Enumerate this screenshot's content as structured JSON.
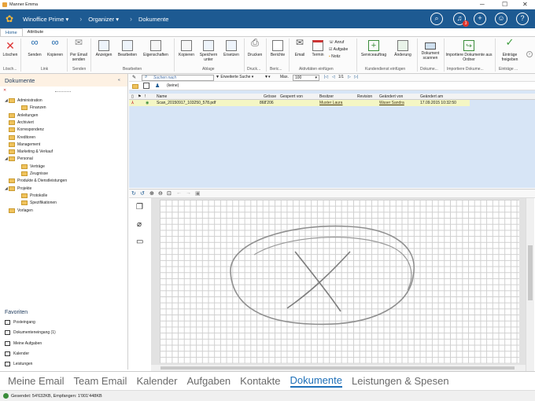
{
  "window": {
    "title": "Manner Emma"
  },
  "appbar": {
    "app": "Winoffice Prime",
    "section": "Organizer",
    "page": "Dokumente",
    "badge": "3"
  },
  "ribbon_tabs": [
    "Home",
    "Attribute"
  ],
  "ribbon": {
    "buttons": [
      {
        "label": "Löschen",
        "icon": "delete-icon"
      },
      {
        "label": "Senden",
        "icon": "link-icon"
      },
      {
        "label": "Kopieren",
        "icon": "link-copy-icon"
      },
      {
        "label": "Per Email senden",
        "icon": "email-send-icon"
      },
      {
        "label": "Anzeigen",
        "icon": "view-icon"
      },
      {
        "label": "Bearbeiten",
        "icon": "edit-icon"
      },
      {
        "label": "Eigenschaften",
        "icon": "properties-icon"
      },
      {
        "label": "Kopieren",
        "icon": "copy-icon"
      },
      {
        "label": "Speichern unter",
        "icon": "save-as-icon"
      },
      {
        "label": "Ersetzen",
        "icon": "replace-icon"
      },
      {
        "label": "Drucken",
        "icon": "print-icon"
      },
      {
        "label": "Berichte",
        "icon": "report-icon"
      },
      {
        "label": "Email",
        "icon": "email-icon"
      },
      {
        "label": "Termin",
        "icon": "calendar-icon"
      },
      {
        "label": "Anruf",
        "icon": "phone-icon"
      },
      {
        "label": "Aufgabe",
        "icon": "task-icon"
      },
      {
        "label": "Notiz",
        "icon": "note-icon"
      },
      {
        "label": "Serviceauftrag",
        "icon": "service-icon"
      },
      {
        "label": "Änderung",
        "icon": "change-icon"
      },
      {
        "label": "Dokument scannen",
        "icon": "scanner-icon"
      },
      {
        "label": "Importiere Dokumente aus Ordner",
        "icon": "import-icon"
      },
      {
        "label": "Einträge freigeben",
        "icon": "check-icon"
      }
    ],
    "groups": [
      "Lösch...",
      "Link",
      "Senden",
      "Bearbeiten",
      "Ablage",
      "Druck...",
      "Beric...",
      "Aktivitäten einfügen",
      "Kundendienst einfügen",
      "Dokume...",
      "Importiere Dokume...",
      "Einträge ..."
    ]
  },
  "left": {
    "title": "Dokumente",
    "tree": [
      {
        "label": "Administration",
        "level": 0,
        "tw": "◢"
      },
      {
        "label": "Finanzen",
        "level": 1,
        "tw": ""
      },
      {
        "label": "Anleitungen",
        "level": 0,
        "tw": ""
      },
      {
        "label": "Archiviert",
        "level": 0,
        "tw": ""
      },
      {
        "label": "Korrespondenz",
        "level": 0,
        "tw": ""
      },
      {
        "label": "Kreditoren",
        "level": 0,
        "tw": ""
      },
      {
        "label": "Management",
        "level": 0,
        "tw": ""
      },
      {
        "label": "Marketing & Verkauf",
        "level": 0,
        "tw": ""
      },
      {
        "label": "Personal",
        "level": 0,
        "tw": "◢"
      },
      {
        "label": "Verträge",
        "level": 1,
        "tw": ""
      },
      {
        "label": "Zeugnisse",
        "level": 1,
        "tw": ""
      },
      {
        "label": "Produkte & Dienstleistungen",
        "level": 0,
        "tw": ""
      },
      {
        "label": "Projekte",
        "level": 0,
        "tw": "◢"
      },
      {
        "label": "Protokolle",
        "level": 1,
        "tw": ""
      },
      {
        "label": "Spezifikationen",
        "level": 1,
        "tw": ""
      },
      {
        "label": "Vorlagen",
        "level": 0,
        "tw": ""
      }
    ],
    "fav_title": "Favoriten",
    "favorites": [
      "Posteingang",
      "Dokumenteneingang (1)",
      "Meine Aufgaben",
      "Kalender",
      "Leistungen"
    ]
  },
  "search": {
    "placeholder": "Suchen nach",
    "adv": "Erweiterte Suche",
    "max_label": "Max.",
    "max_value": "100",
    "page": "1/1",
    "filter": "(keine)"
  },
  "grid": {
    "headers": [
      "Name",
      "Grösse",
      "Gesperrt von",
      "Besitzer",
      "Revision",
      "Geändert von",
      "Geändert am"
    ],
    "row": {
      "name": "Scan_20150917_103250_578.pdf",
      "size": "868'206",
      "locked": "",
      "owner": "Muster Laura",
      "revision": "",
      "changed_by": "Waser Sandra",
      "changed_at": "17.09.2015 10:32:50"
    }
  },
  "nav": [
    "Meine Email",
    "Team Email",
    "Kalender",
    "Aufgaben",
    "Kontakte",
    "Dokumente",
    "Leistungen & Spesen"
  ],
  "nav_selected": "Dokumente",
  "status": "Gesendet: 54'632KB, Empfangen: 1'001'448KB"
}
